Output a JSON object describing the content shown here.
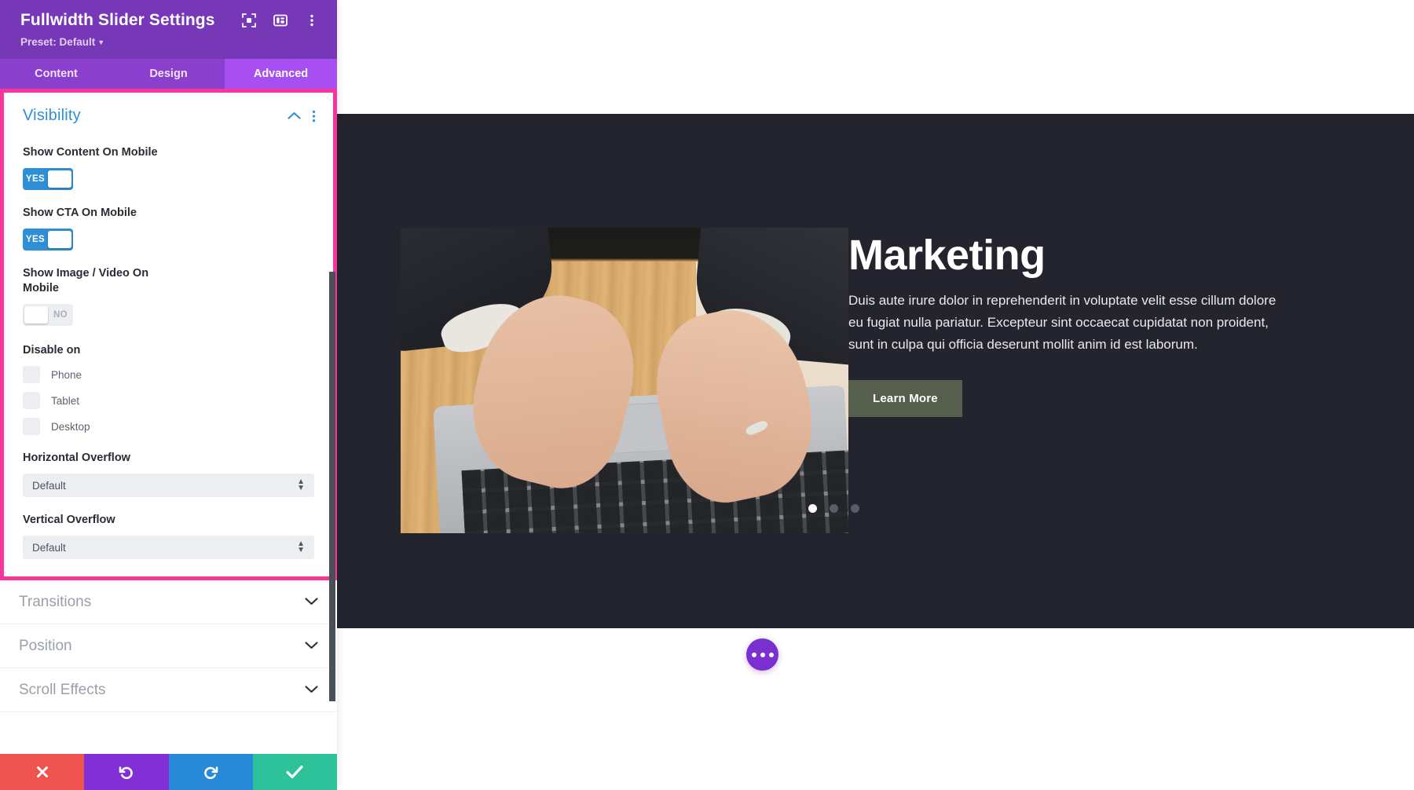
{
  "panel": {
    "title": "Fullwidth Slider Settings",
    "preset_label": "Preset: Default",
    "icons": {
      "focus": "focus-icon",
      "layout": "layout-panel-icon",
      "more": "more-vertical-icon"
    },
    "tabs": [
      {
        "label": "Content",
        "active": false
      },
      {
        "label": "Design",
        "active": false
      },
      {
        "label": "Advanced",
        "active": true
      }
    ],
    "visibility_group": {
      "title": "Visibility",
      "collapse_icon": "chevron-up-icon",
      "options_icon": "more-vertical-icon",
      "fields": [
        {
          "label": "Show Content On Mobile",
          "type": "toggle",
          "value": "YES",
          "state": "on"
        },
        {
          "label": "Show CTA On Mobile",
          "type": "toggle",
          "value": "YES",
          "state": "on"
        },
        {
          "label": "Show Image / Video On Mobile",
          "type": "toggle",
          "value": "NO",
          "state": "off"
        }
      ],
      "disable_on": {
        "label": "Disable on",
        "items": [
          {
            "label": "Phone",
            "checked": false
          },
          {
            "label": "Tablet",
            "checked": false
          },
          {
            "label": "Desktop",
            "checked": false
          }
        ]
      },
      "overflow": [
        {
          "label": "Horizontal Overflow",
          "value": "Default"
        },
        {
          "label": "Vertical Overflow",
          "value": "Default"
        }
      ]
    },
    "collapsed_groups": [
      {
        "label": "Transitions",
        "icon": "chevron-down-icon"
      },
      {
        "label": "Position",
        "icon": "chevron-down-icon"
      },
      {
        "label": "Scroll Effects",
        "icon": "chevron-down-icon"
      }
    ],
    "actions": [
      {
        "name": "cancel",
        "icon": "close-x-icon",
        "color": "#ef5350"
      },
      {
        "name": "undo",
        "icon": "undo-arrow-icon",
        "color": "#8230d6"
      },
      {
        "name": "redo",
        "icon": "redo-arrow-icon",
        "color": "#2789d8"
      },
      {
        "name": "save",
        "icon": "checkmark-icon",
        "color": "#2ec29a"
      }
    ],
    "colors": {
      "header_bg": "#7638b6",
      "tabs_bg": "#8a3fcd",
      "tab_active_bg": "#a74ff0",
      "highlight_border": "#f9359c",
      "group_title": "#2c8fd8",
      "toggle_on": "#2d8fd5"
    }
  },
  "preview": {
    "slide": {
      "heading": "Marketing",
      "body": "Duis aute irure dolor in reprehenderit in voluptate velit esse cillum dolore eu fugiat nulla pariatur. Excepteur sint occaecat cupidatat non proident, sunt in culpa qui officia deserunt mollit anim id est laborum.",
      "button_label": "Learn More",
      "image_alt": "hands typing on a laptop on a wooden desk",
      "background_color": "#23242e",
      "button_color": "#565f4d"
    },
    "pagination": {
      "total": 3,
      "active_index": 0
    },
    "fab": {
      "icon": "ellipsis-icon",
      "color": "#7b2fd1"
    }
  }
}
